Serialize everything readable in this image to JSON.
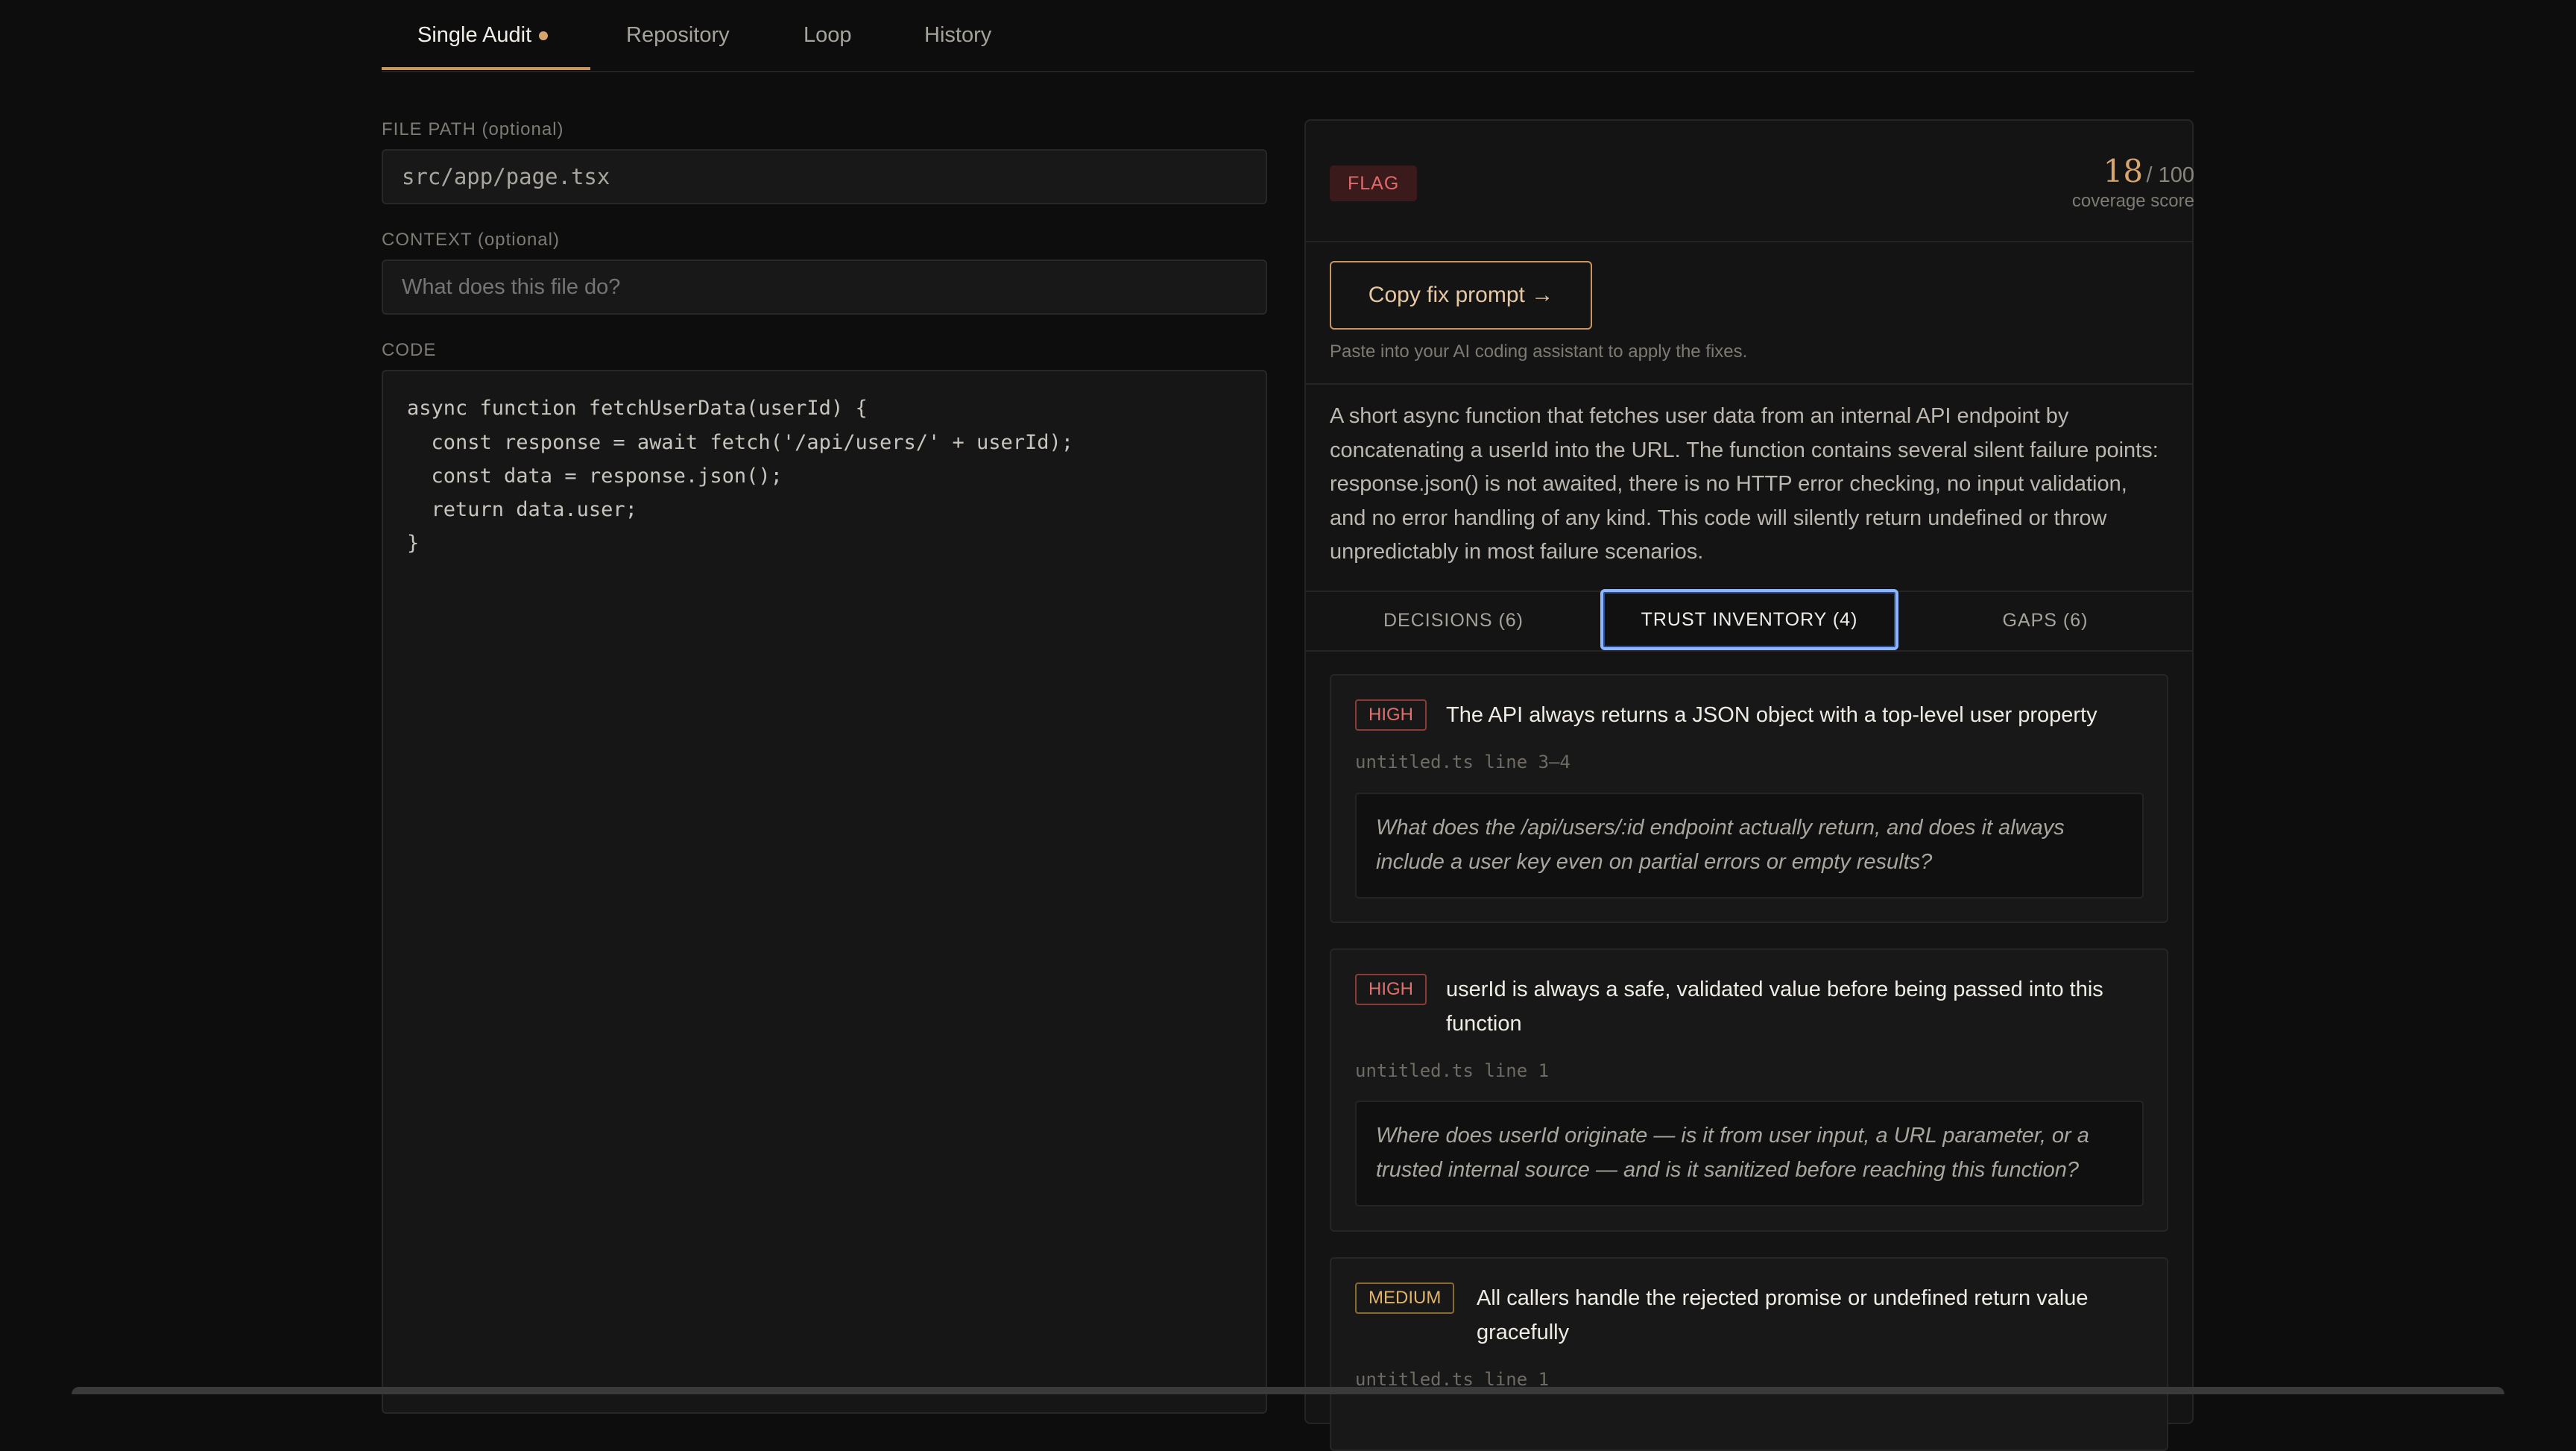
{
  "tabs": [
    {
      "label": "Single Audit",
      "active": true,
      "indicator": true
    },
    {
      "label": "Repository"
    },
    {
      "label": "Loop"
    },
    {
      "label": "History"
    }
  ],
  "form": {
    "file_path_label": "FILE PATH (optional)",
    "file_path_value": "src/app/page.tsx",
    "context_label": "CONTEXT (optional)",
    "context_placeholder": "What does this file do?",
    "code_label": "CODE",
    "code_lines": [
      "async function fetchUserData(userId) {",
      "  const response = await fetch('/api/users/' + userId);",
      "  const data = response.json();",
      "  return data.user;",
      "}"
    ]
  },
  "result": {
    "verdict": "FLAG",
    "score": "18",
    "score_max": "/ 100",
    "score_caption": "coverage score",
    "copy_button": "Copy fix prompt →",
    "copy_hint": "Paste into your AI coding assistant to apply the fixes.",
    "summary": "A short async function that fetches user data from an internal API endpoint by concatenating a userId into the URL. The function contains several silent failure points: response.json() is not awaited, there is no HTTP error checking, no input validation, and no error handling of any kind. This code will silently return undefined or throw unpredictably in most failure scenarios.",
    "subtabs": [
      {
        "label": "DECISIONS (6)"
      },
      {
        "label": "TRUST INVENTORY (4)",
        "active": true
      },
      {
        "label": "GAPS (6)"
      }
    ],
    "items": [
      {
        "severity": "HIGH",
        "title": "The API always returns a JSON object with a top-level user property",
        "location": "untitled.ts line 3–4",
        "question": "What does the /api/users/:id endpoint actually return, and does it always include a user key even on partial errors or empty results?"
      },
      {
        "severity": "HIGH",
        "title": "userId is always a safe, validated value before being passed into this function",
        "location": "untitled.ts line 1",
        "question": "Where does userId originate — is it from user input, a URL parameter, or a trusted internal source — and is it sanitized before reaching this function?"
      },
      {
        "severity": "MEDIUM",
        "title": "All callers handle the rejected promise or undefined return value gracefully",
        "location": "untitled.ts line 1"
      }
    ]
  },
  "colors": {
    "accent": "#c99662",
    "focus_ring": "#8db4ff",
    "high": "#e0706a",
    "medium": "#e0b46c"
  }
}
